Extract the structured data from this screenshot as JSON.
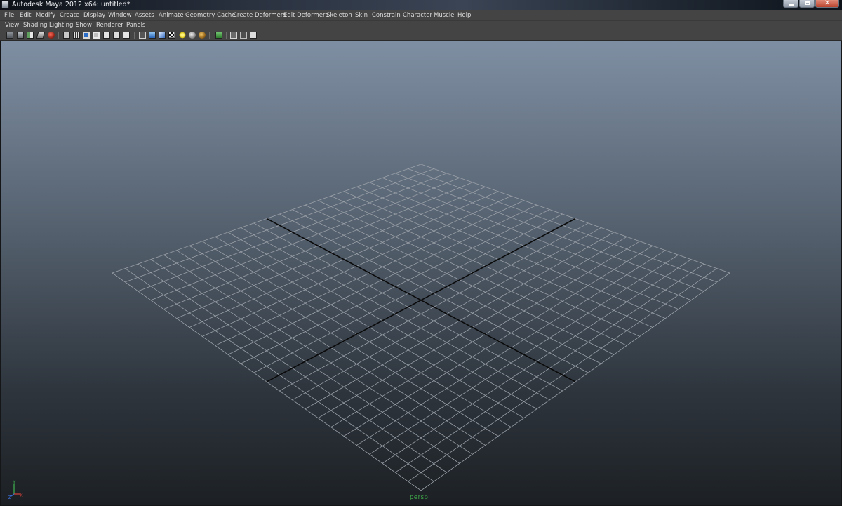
{
  "window": {
    "title": "Autodesk Maya 2012 x64: untitled*"
  },
  "menus": [
    "File",
    "Edit",
    "Modify",
    "Create",
    "Display",
    "Window",
    "Assets",
    "Animate",
    "Geometry Cache",
    "Create Deformers",
    "Edit Deformers",
    "Skeleton",
    "Skin",
    "Constrain",
    "Character",
    "Muscle",
    "Help"
  ],
  "panel_menus": [
    "View",
    "Shading",
    "Lighting",
    "Show",
    "Renderer",
    "Panels"
  ],
  "toolbar_icons": [
    "select-camera-icon",
    "camera-attributes-icon",
    "bookmark-icon",
    "image-plane-icon",
    "grease-pencil-icon",
    "grid-icon",
    "film-gate-icon",
    "resolution-gate-icon",
    "gate-mask-icon",
    "field-chart-icon",
    "safe-action-icon",
    "safe-title-icon",
    "wireframe-icon",
    "smooth-shade-icon",
    "textured-icon",
    "lights-icon",
    "shadows-icon",
    "default-material-icon",
    "isolate-select-icon",
    "xray-icon",
    "xray-joints-icon",
    "hardware-fog-icon"
  ],
  "viewport": {
    "camera_label": "persp",
    "axis_labels": {
      "x": "X",
      "y": "Y",
      "z": "Z"
    },
    "colors": {
      "grid_lines": "#9aa0a8",
      "axis_lines": "#0a0a0a",
      "camera_label": "#3fae4a",
      "gradient_top": "#7f8fa3",
      "gradient_bottom": "#1c2024"
    }
  }
}
